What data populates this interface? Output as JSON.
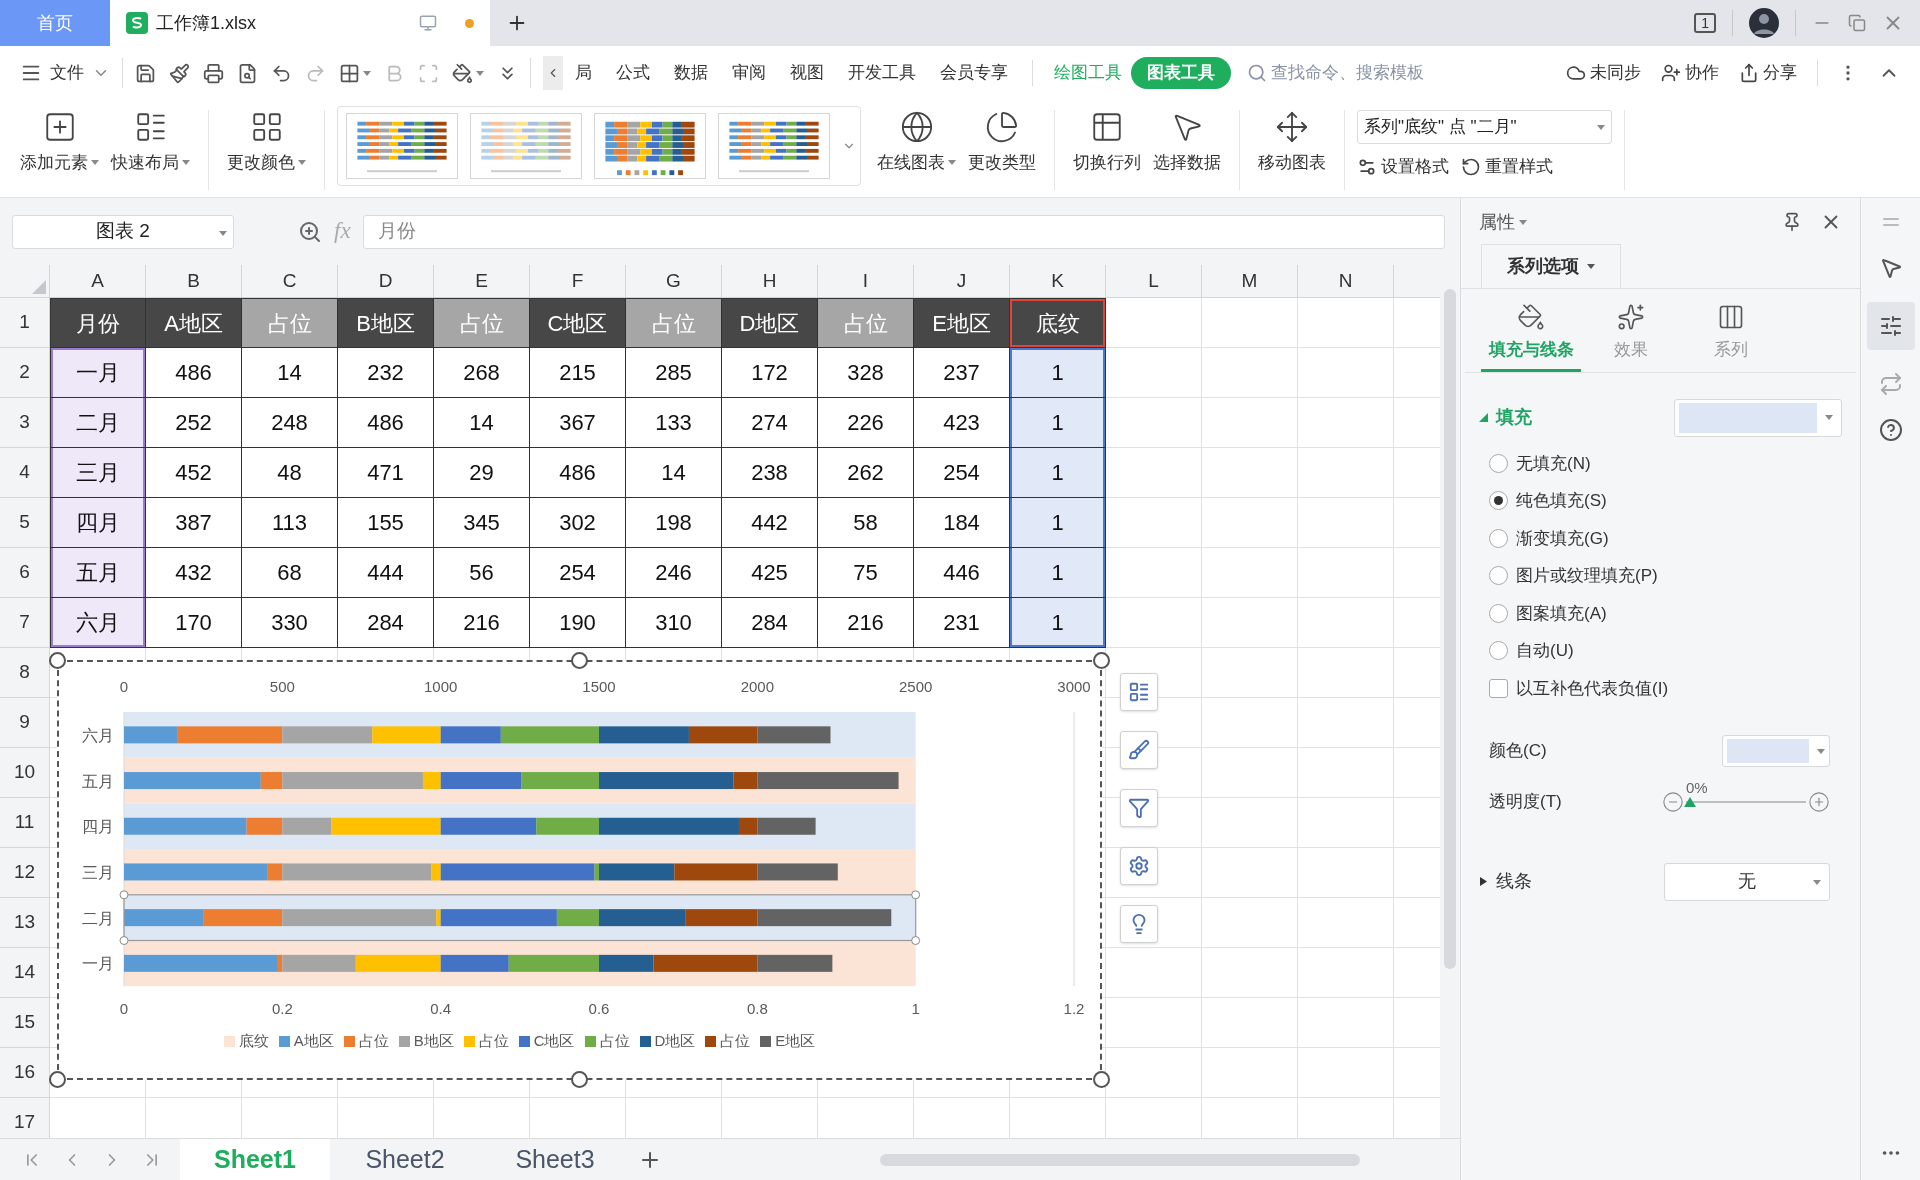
{
  "title_bar": {
    "tabs": [
      {
        "kind": "home",
        "label": "首页",
        "selected": false
      },
      {
        "kind": "file",
        "label": "工作簿1.xlsx",
        "selected": true,
        "unsaved": true
      }
    ],
    "window_count": "1"
  },
  "menu_bar": {
    "file_menu": "文件",
    "tabs": [
      {
        "label": "局",
        "kind": "normal",
        "selected": false
      },
      {
        "label": "公式",
        "kind": "normal",
        "selected": false
      },
      {
        "label": "数据",
        "kind": "normal",
        "selected": false
      },
      {
        "label": "审阅",
        "kind": "normal",
        "selected": false
      },
      {
        "label": "视图",
        "kind": "normal",
        "selected": false
      },
      {
        "label": "开发工具",
        "kind": "normal",
        "selected": false
      },
      {
        "label": "会员专享",
        "kind": "normal",
        "selected": false
      },
      {
        "label": "绘图工具",
        "kind": "context",
        "selected": false
      },
      {
        "label": "图表工具",
        "kind": "context",
        "selected": true
      }
    ],
    "search": {
      "placeholder": "查找命令、搜索模板"
    },
    "actions": [
      "未同步",
      "协作",
      "分享"
    ]
  },
  "ribbon": {
    "buttons_left": [
      {
        "label": "添加元素",
        "dropdown": true
      },
      {
        "label": "快速布局",
        "dropdown": true
      },
      {
        "label": "更改颜色",
        "dropdown": true
      }
    ],
    "gallery": [
      {
        "kind": "light"
      },
      {
        "kind": "pale"
      },
      {
        "kind": "bold"
      },
      {
        "kind": "light"
      }
    ],
    "buttons_right": [
      {
        "label": "在线图表",
        "dropdown": true
      },
      {
        "label": "更改类型",
        "dropdown": false
      },
      {
        "label": "切换行列",
        "dropdown": false
      },
      {
        "label": "选择数据",
        "dropdown": false
      },
      {
        "label": "移动图表",
        "dropdown": false
      }
    ],
    "element_selector": "系列\"底纹\" 点 \"二月\"",
    "format_buttons": [
      "设置格式",
      "重置样式"
    ]
  },
  "formula_bar": {
    "name_box": "图表 2",
    "fx": "fx",
    "formula": "月份"
  },
  "sheet": {
    "columns": [
      "A",
      "B",
      "C",
      "D",
      "E",
      "F",
      "G",
      "H",
      "I",
      "J",
      "K",
      "L",
      "M",
      "N"
    ],
    "row_numbers": [
      "1",
      "2",
      "3",
      "4",
      "5",
      "6",
      "7",
      "8",
      "9",
      "10",
      "11",
      "12",
      "13",
      "14",
      "15",
      "16",
      "17"
    ]
  },
  "table": {
    "header": [
      {
        "text": "月份",
        "kind": "dark",
        "category_column": true,
        "values_column": false,
        "name_selected": false
      },
      {
        "text": "A地区",
        "kind": "dark",
        "category_column": false,
        "values_column": false,
        "name_selected": false
      },
      {
        "text": "占位",
        "kind": "light",
        "category_column": false,
        "values_column": false,
        "name_selected": false
      },
      {
        "text": "B地区",
        "kind": "dark",
        "category_column": false,
        "values_column": false,
        "name_selected": false
      },
      {
        "text": "占位",
        "kind": "light",
        "category_column": false,
        "values_column": false,
        "name_selected": false
      },
      {
        "text": "C地区",
        "kind": "dark",
        "category_column": false,
        "values_column": false,
        "name_selected": false
      },
      {
        "text": "占位",
        "kind": "light",
        "category_column": false,
        "values_column": false,
        "name_selected": false
      },
      {
        "text": "D地区",
        "kind": "dark",
        "category_column": false,
        "values_column": false,
        "name_selected": false
      },
      {
        "text": "占位",
        "kind": "light",
        "category_column": false,
        "values_column": false,
        "name_selected": false
      },
      {
        "text": "E地区",
        "kind": "dark",
        "category_column": false,
        "values_column": false,
        "name_selected": false
      },
      {
        "text": "底纹",
        "kind": "dark",
        "category_column": false,
        "values_column": true,
        "name_selected": true
      }
    ],
    "rows": [
      [
        "一月",
        "486",
        "14",
        "232",
        "268",
        "215",
        "285",
        "172",
        "328",
        "237",
        "1"
      ],
      [
        "二月",
        "252",
        "248",
        "486",
        "14",
        "367",
        "133",
        "274",
        "226",
        "423",
        "1"
      ],
      [
        "三月",
        "452",
        "48",
        "471",
        "29",
        "486",
        "14",
        "238",
        "262",
        "254",
        "1"
      ],
      [
        "四月",
        "387",
        "113",
        "155",
        "345",
        "302",
        "198",
        "442",
        "58",
        "184",
        "1"
      ],
      [
        "五月",
        "432",
        "68",
        "444",
        "56",
        "254",
        "246",
        "425",
        "75",
        "446",
        "1"
      ],
      [
        "六月",
        "170",
        "330",
        "284",
        "216",
        "190",
        "310",
        "284",
        "216",
        "231",
        "1"
      ]
    ]
  },
  "chart": {
    "chart_data": {
      "type": "bar",
      "orientation": "horizontal",
      "stacked": true,
      "categories": [
        "六月",
        "五月",
        "四月",
        "三月",
        "二月",
        "一月"
      ],
      "xlim": [
        0,
        3000
      ],
      "xticks": [
        0,
        500,
        1000,
        1500,
        2000,
        2500,
        3000
      ],
      "series": [
        {
          "name": "A地区",
          "color": "#5b9bd5",
          "values": [
            170,
            432,
            387,
            452,
            252,
            486
          ]
        },
        {
          "name": "占位",
          "color": "#ed7d31",
          "values": [
            330,
            68,
            113,
            48,
            248,
            14
          ]
        },
        {
          "name": "B地区",
          "color": "#a5a5a5",
          "values": [
            284,
            444,
            155,
            471,
            486,
            232
          ]
        },
        {
          "name": "占位",
          "color": "#ffc000",
          "values": [
            216,
            56,
            345,
            29,
            14,
            268
          ]
        },
        {
          "name": "C地区",
          "color": "#4472c4",
          "values": [
            190,
            254,
            302,
            486,
            367,
            215
          ]
        },
        {
          "name": "占位",
          "color": "#70ad47",
          "values": [
            310,
            246,
            198,
            14,
            133,
            285
          ]
        },
        {
          "name": "D地区",
          "color": "#255e91",
          "values": [
            284,
            425,
            442,
            238,
            274,
            172
          ]
        },
        {
          "name": "占位",
          "color": "#9e480e",
          "values": [
            216,
            75,
            58,
            262,
            226,
            328
          ]
        },
        {
          "name": "E地区",
          "color": "#636363",
          "values": [
            231,
            446,
            184,
            254,
            423,
            237
          ]
        }
      ]
    },
    "background_series": {
      "name": "底纹",
      "color": "#fbe3d6",
      "points": [
        {
          "color": "#dde8f4",
          "selected": false
        },
        {
          "color": "#fbe3d6",
          "selected": false
        },
        {
          "color": "#dde8f4",
          "selected": false
        },
        {
          "color": "#fbe3d6",
          "selected": false
        },
        {
          "color": "#dde8f4",
          "selected": true
        },
        {
          "color": "#fbe3d6",
          "selected": false
        }
      ]
    },
    "secondary_axis_ticks": [
      "0",
      "0.2",
      "0.4",
      "0.6",
      "0.8",
      "1",
      "1.2"
    ]
  },
  "panel": {
    "title": "属性",
    "tab": "系列选项",
    "subtabs": [
      {
        "label": "填充与线条",
        "selected": true
      },
      {
        "label": "效果",
        "selected": false
      },
      {
        "label": "系列",
        "selected": false
      }
    ],
    "fill": {
      "label": "填充",
      "expanded": true,
      "color": "#dce6f4",
      "options": [
        {
          "label": "无填充(N)",
          "selected": false
        },
        {
          "label": "纯色填充(S)",
          "selected": true
        },
        {
          "label": "渐变填充(G)",
          "selected": false
        },
        {
          "label": "图片或纹理填充(P)",
          "selected": false
        },
        {
          "label": "图案填充(A)",
          "selected": false
        },
        {
          "label": "自动(U)",
          "selected": false
        }
      ],
      "checkbox": {
        "label": "以互补色代表负值(I)",
        "checked": false
      },
      "color_row": {
        "label": "颜色(C)",
        "color": "#dce6f4"
      },
      "transparency": {
        "label": "透明度(T)",
        "level": 0,
        "reading": "0%"
      }
    },
    "line": {
      "label": "线条",
      "expanded": false,
      "value": "无"
    }
  },
  "sheet_tabs": [
    {
      "label": "Sheet1",
      "selected": true
    },
    {
      "label": "Sheet2",
      "selected": false
    },
    {
      "label": "Sheet3",
      "selected": false
    }
  ]
}
